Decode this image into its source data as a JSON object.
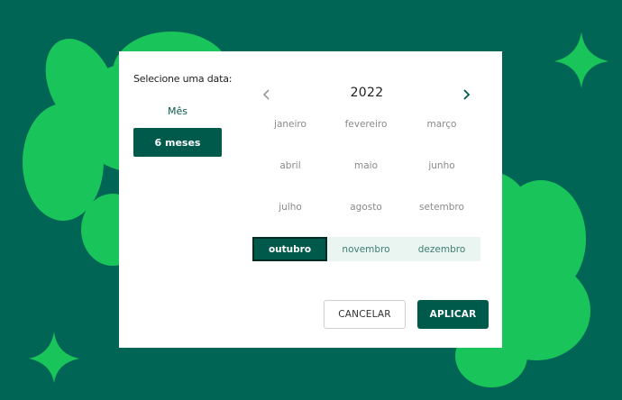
{
  "colors": {
    "background": "#006554",
    "accent_green": "#19c45a",
    "primary": "#005a4b",
    "range_highlight": "#eaf5f2"
  },
  "picker": {
    "prompt": "Selecione uma data:",
    "period_options": [
      {
        "label": "Mês",
        "selected": false
      },
      {
        "label": "6 meses",
        "selected": true
      }
    ],
    "year": "2022",
    "prev_icon": "chevron-left-icon",
    "next_icon": "chevron-right-icon",
    "months": [
      "janeiro",
      "fevereiro",
      "março",
      "abril",
      "maio",
      "junho",
      "julho",
      "agosto",
      "setembro",
      "outubro",
      "novembro",
      "dezembro"
    ],
    "selected_month": "outubro",
    "range_months": [
      "novembro",
      "dezembro"
    ]
  },
  "actions": {
    "cancel": "CANCELAR",
    "apply": "APLICAR"
  }
}
